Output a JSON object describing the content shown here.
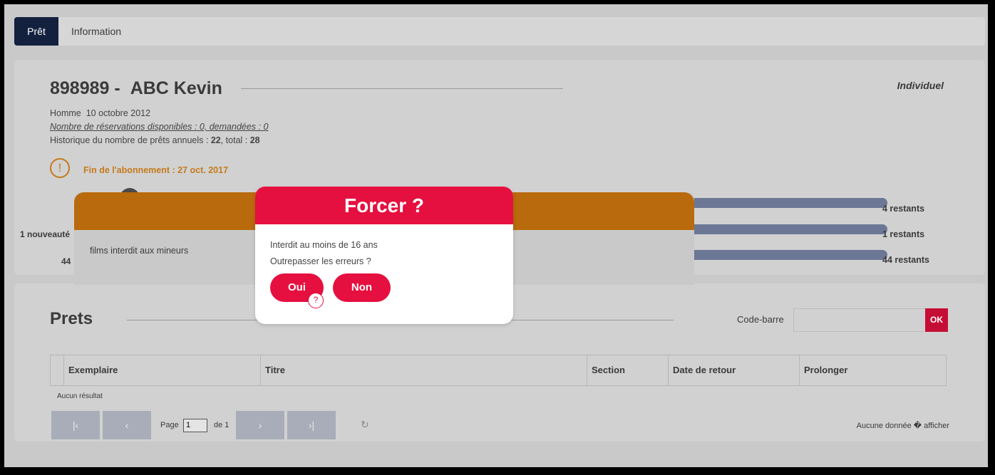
{
  "tabs": {
    "pret": "Prêt",
    "information": "Information"
  },
  "patient": {
    "id": "898989 -",
    "name": "ABC Kevin",
    "type": "Individuel",
    "gender": "Homme",
    "birthdate": "10 octobre 2012",
    "reservations": "Nombre de réservations disponibles : 0, demandées : 0",
    "history_prefix": "Historique du nombre de prêts annuels : ",
    "annual": "22",
    "history_mid": ", total : ",
    "total": "28"
  },
  "warning": {
    "text": "Fin de l'abonnement : 27 oct. 2017"
  },
  "quotas": {
    "r1": "4 restants",
    "r2": "1 restants",
    "r3": "44 restants",
    "left1": "1 nouveauté",
    "left2": "44"
  },
  "alert_panel": {
    "text": "films interdit aux mineurs"
  },
  "modal": {
    "title": "Forcer ?",
    "line1": "Interdit au moins de 16 ans",
    "line2": "Outrepasser les erreurs ?",
    "oui": "Oui",
    "non": "Non",
    "cursor_glyph": "?"
  },
  "prets": {
    "title": "Prets",
    "barcode_label": "Code-barre",
    "barcode_value": "",
    "ok": "OK",
    "columns": [
      "Exemplaire",
      "Titre",
      "Section",
      "Date de retour",
      "Prolonger"
    ],
    "no_result": "Aucun résultat",
    "page_label": "Page",
    "page_value": "1",
    "page_of": "de 1",
    "no_data": "Aucune donnée � afficher",
    "nav": {
      "first": "|‹",
      "prev": "‹",
      "next": "›",
      "last": "›|",
      "refresh": "↻"
    }
  },
  "colors": {
    "primary": "#e5103f",
    "dark_tab": "#13213f",
    "warning": "#c57a1c",
    "orange_panel": "#b96a0c",
    "bar": "#6b7794"
  }
}
